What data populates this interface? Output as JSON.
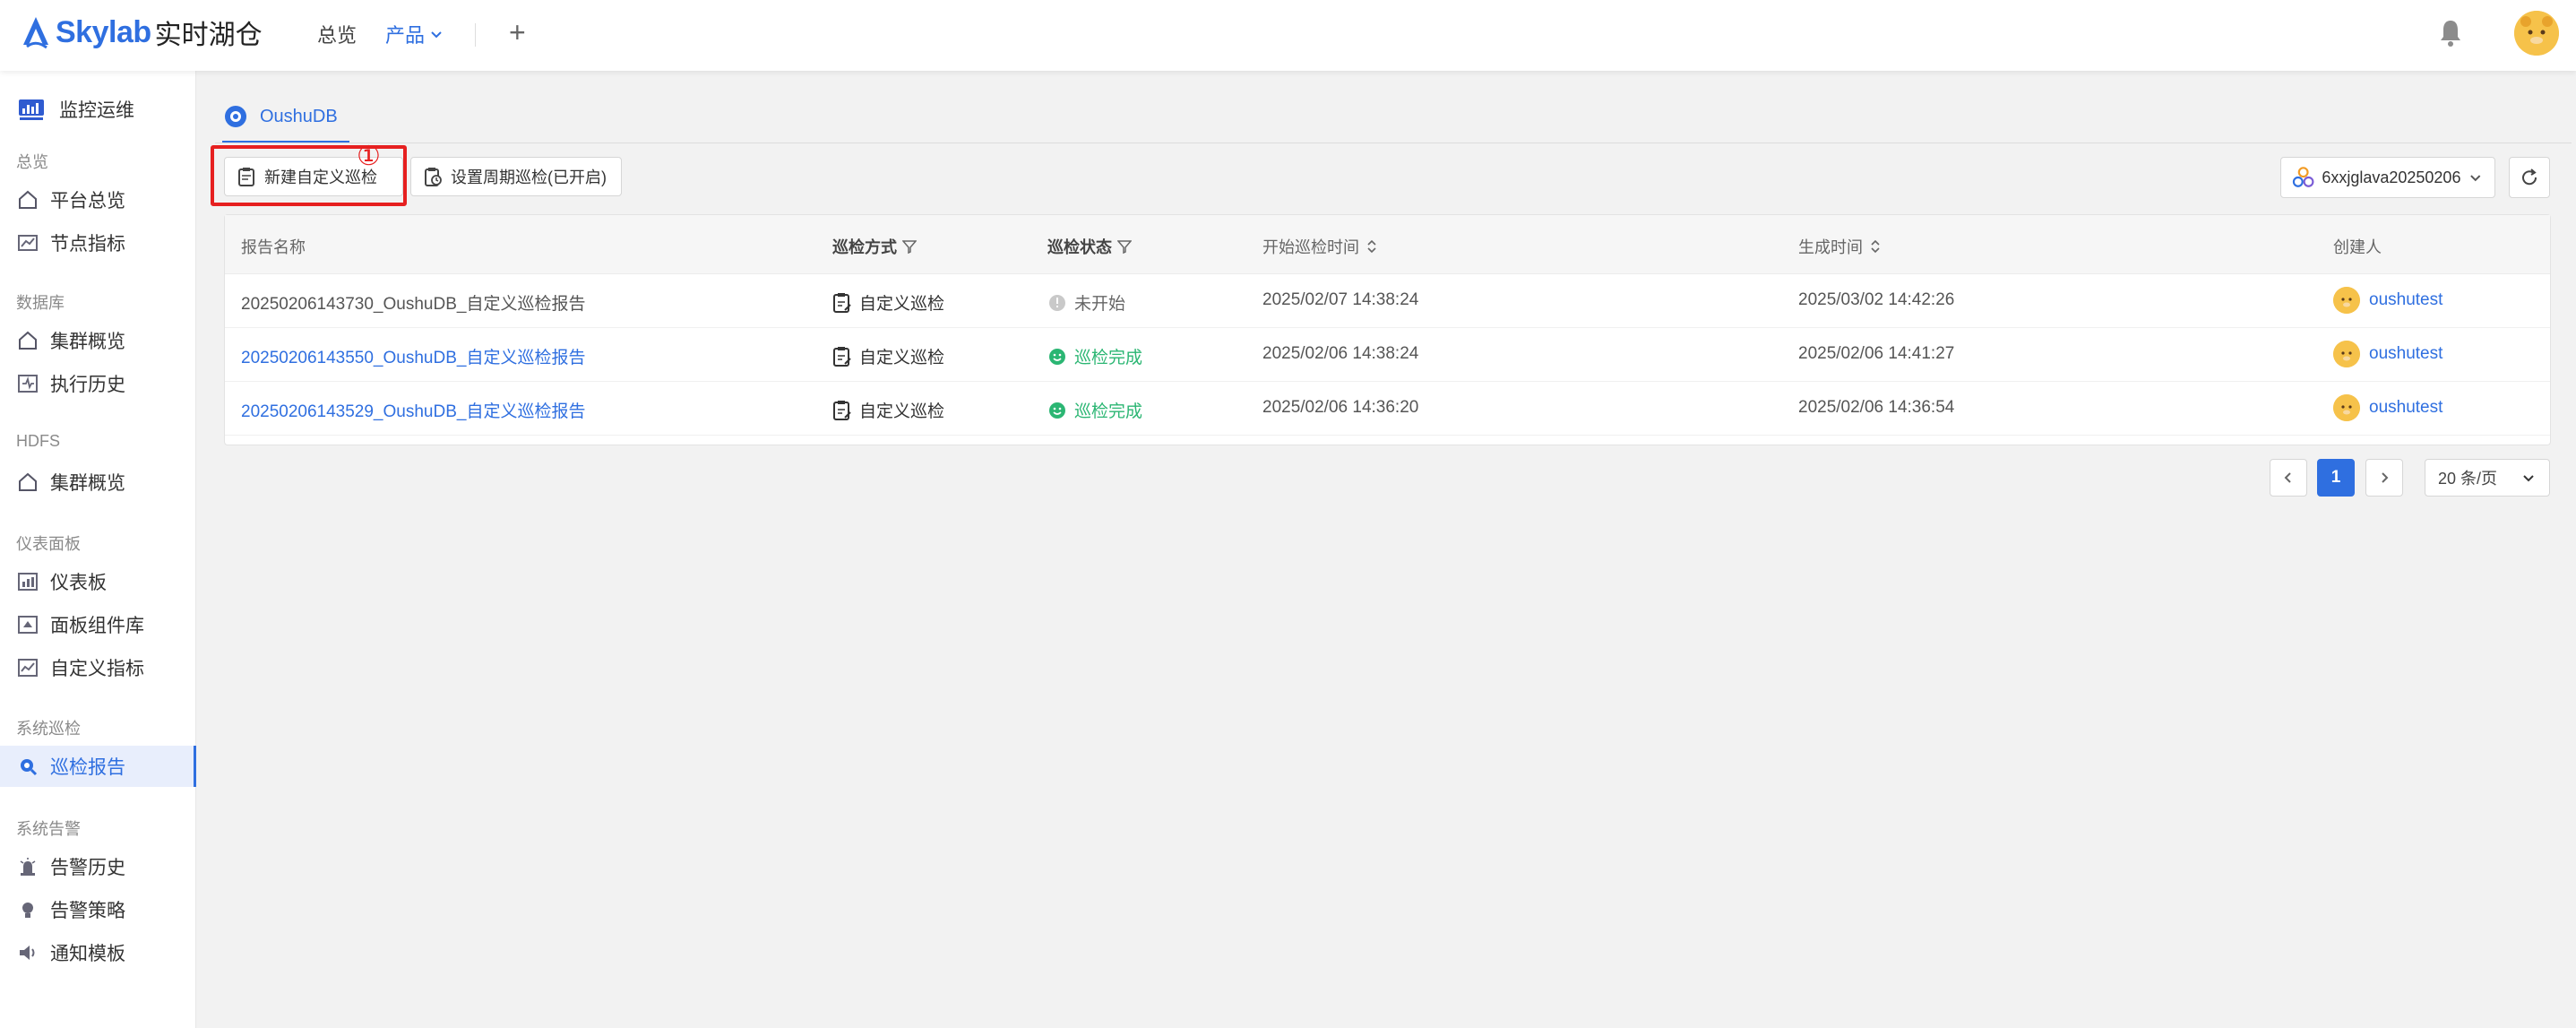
{
  "header": {
    "logo_text": "Skylab",
    "logo_sub": "实时湖仓",
    "nav_overview": "总览",
    "nav_product": "产品",
    "nav_plus": "+"
  },
  "sidebar": {
    "top_item": "监控运维",
    "groups": [
      {
        "label": "总览",
        "items": [
          "平台总览",
          "节点指标"
        ]
      },
      {
        "label": "数据库",
        "items": [
          "集群概览",
          "执行历史"
        ]
      },
      {
        "label": "HDFS",
        "items": [
          "集群概览"
        ]
      },
      {
        "label": "仪表面板",
        "items": [
          "仪表板",
          "面板组件库",
          "自定义指标"
        ]
      },
      {
        "label": "系统巡检",
        "items": [
          "巡检报告"
        ]
      },
      {
        "label": "系统告警",
        "items": [
          "告警历史",
          "告警策略",
          "通知模板"
        ]
      }
    ],
    "active_item": "巡检报告"
  },
  "main": {
    "tab_label": "OushuDB",
    "btn_new": "新建自定义巡检",
    "btn_period": "设置周期巡检(已开启)",
    "annotation_marker": "①",
    "cluster_select": "6xxjglava20250206",
    "table": {
      "headers": [
        "报告名称",
        "巡检方式",
        "巡检状态",
        "开始巡检时间",
        "生成时间",
        "创建人"
      ],
      "rows": [
        {
          "name": "20250206143730_OushuDB_自定义巡检报告",
          "method": "自定义巡检",
          "status": "未开始",
          "start": "2025/02/07 14:38:24",
          "generated": "2025/03/02 14:42:26",
          "creator": "oushutest"
        },
        {
          "name": "20250206143550_OushuDB_自定义巡检报告",
          "method": "自定义巡检",
          "status": "巡检完成",
          "start": "2025/02/06 14:38:24",
          "generated": "2025/02/06 14:41:27",
          "creator": "oushutest"
        },
        {
          "name": "20250206143529_OushuDB_自定义巡检报告",
          "method": "自定义巡检",
          "status": "巡检完成",
          "start": "2025/02/06 14:36:20",
          "generated": "2025/02/06 14:36:54",
          "creator": "oushutest"
        }
      ]
    },
    "pagination": {
      "current_page": "1",
      "page_size": "20 条/页"
    }
  },
  "colors": {
    "brand": "#2f6fe0",
    "success": "#2bb673",
    "highlight": "#e62020"
  }
}
